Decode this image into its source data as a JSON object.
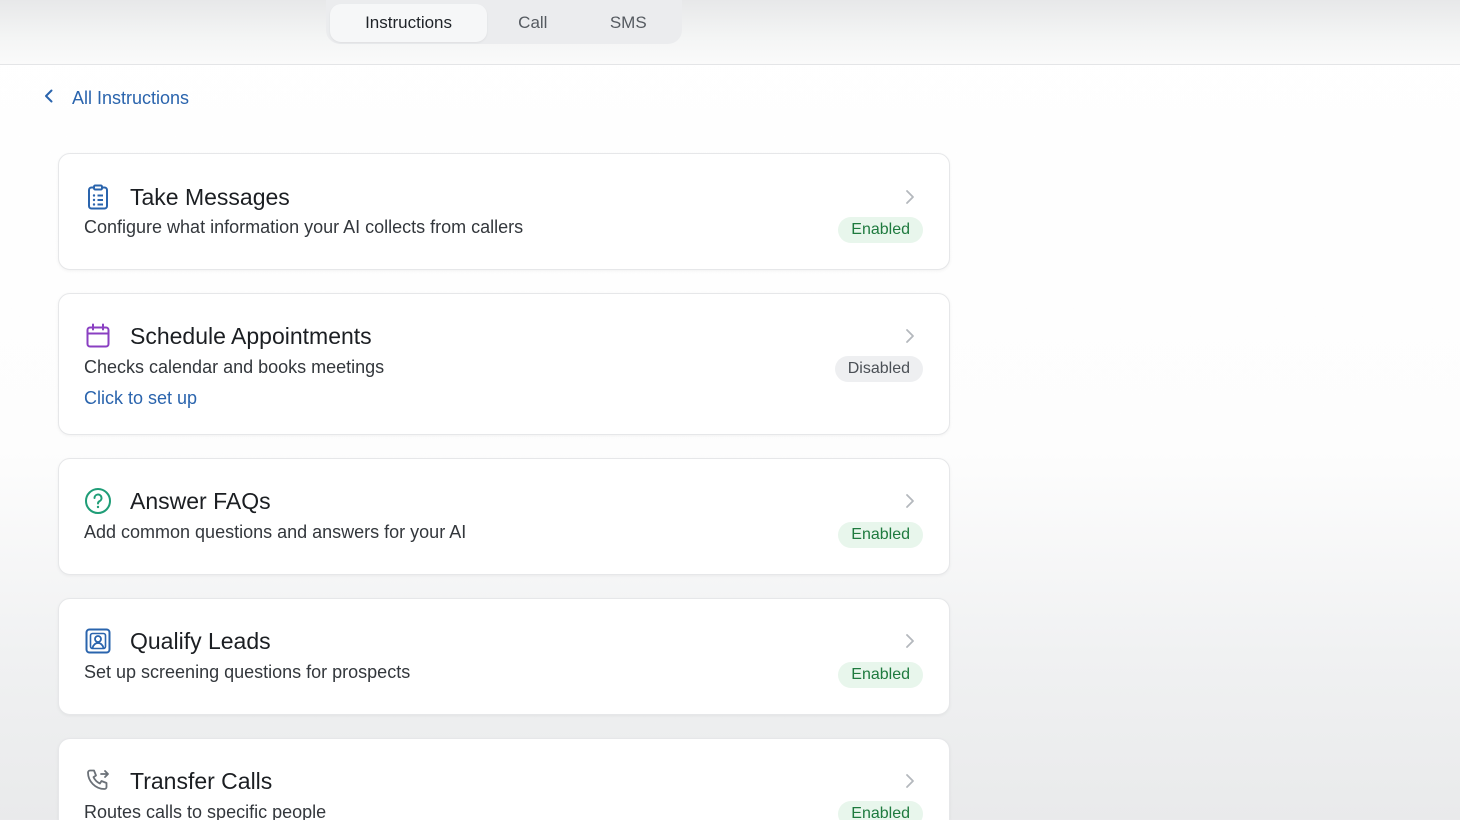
{
  "tabs": [
    {
      "label": "Instructions",
      "active": true
    },
    {
      "label": "Call",
      "active": false
    },
    {
      "label": "SMS",
      "active": false
    }
  ],
  "back_link": {
    "label": "All Instructions",
    "icon": "chevron-left-icon"
  },
  "colors": {
    "link": "#2a64ad",
    "enabled_bg": "#e8f6ec",
    "enabled_text": "#1e7a3e",
    "disabled_bg": "#eeeff1",
    "icon_take_messages": "#2a64ad",
    "icon_schedule": "#8a3fc2",
    "icon_faq": "#1f9d77",
    "icon_leads": "#2a64ad",
    "icon_transfer": "#6b7178"
  },
  "cards": [
    {
      "title": "Take Messages",
      "description": "Configure what information your AI collects from callers",
      "status": "Enabled",
      "icon": "clipboard-list-icon"
    },
    {
      "title": "Schedule Appointments",
      "description": "Checks calendar and books meetings",
      "link": "Click to set up",
      "status": "Disabled",
      "icon": "calendar-icon"
    },
    {
      "title": "Answer FAQs",
      "description": "Add common questions and answers for your AI",
      "status": "Enabled",
      "icon": "question-circle-icon"
    },
    {
      "title": "Qualify Leads",
      "description": "Set up screening questions for prospects",
      "status": "Enabled",
      "icon": "user-square-icon"
    },
    {
      "title": "Transfer Calls",
      "description": "Routes calls to specific people",
      "status": "Enabled",
      "icon": "phone-forward-icon"
    }
  ]
}
